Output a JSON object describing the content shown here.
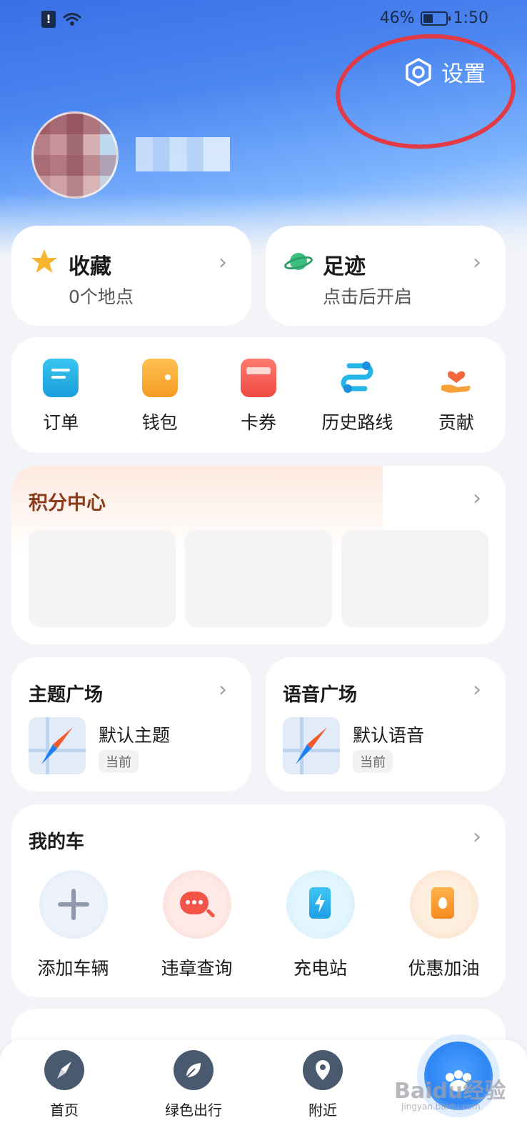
{
  "status_bar": {
    "battery": "46%",
    "battery_level": 0.46,
    "time": "1:50"
  },
  "header": {
    "settings_label": "设置"
  },
  "quick_cards": [
    {
      "title": "收藏",
      "subtitle": "0个地点",
      "icon": "star-icon"
    },
    {
      "title": "足迹",
      "subtitle": "点击后开启",
      "icon": "planet-icon"
    }
  ],
  "services": [
    {
      "label": "订单",
      "icon": "order-icon"
    },
    {
      "label": "钱包",
      "icon": "wallet-icon"
    },
    {
      "label": "卡券",
      "icon": "coupon-icon"
    },
    {
      "label": "历史路线",
      "icon": "route-icon"
    },
    {
      "label": "贡献",
      "icon": "contribute-icon"
    }
  ],
  "points": {
    "title": "积分中心"
  },
  "theme": {
    "title": "主题广场",
    "item": "默认主题",
    "badge": "当前"
  },
  "voice": {
    "title": "语音广场",
    "item": "默认语音",
    "badge": "当前"
  },
  "my_car": {
    "title": "我的车",
    "items": [
      {
        "label": "添加车辆",
        "icon": "plus-icon"
      },
      {
        "label": "违章查询",
        "icon": "violation-search-icon"
      },
      {
        "label": "充电站",
        "icon": "charging-station-icon"
      },
      {
        "label": "优惠加油",
        "icon": "fuel-icon"
      }
    ]
  },
  "tabbar": {
    "items": [
      {
        "label": "首页",
        "icon": "compass-icon"
      },
      {
        "label": "绿色出行",
        "icon": "leaf-icon"
      },
      {
        "label": "附近",
        "icon": "location-pin-icon"
      }
    ]
  },
  "watermark": {
    "text": "Baidu经验",
    "sub": "jingyan.baidu.com"
  },
  "colors": {
    "accent": "#2e86f5",
    "highlight_ring": "#e23a46",
    "points_title": "#8a3b1c"
  }
}
